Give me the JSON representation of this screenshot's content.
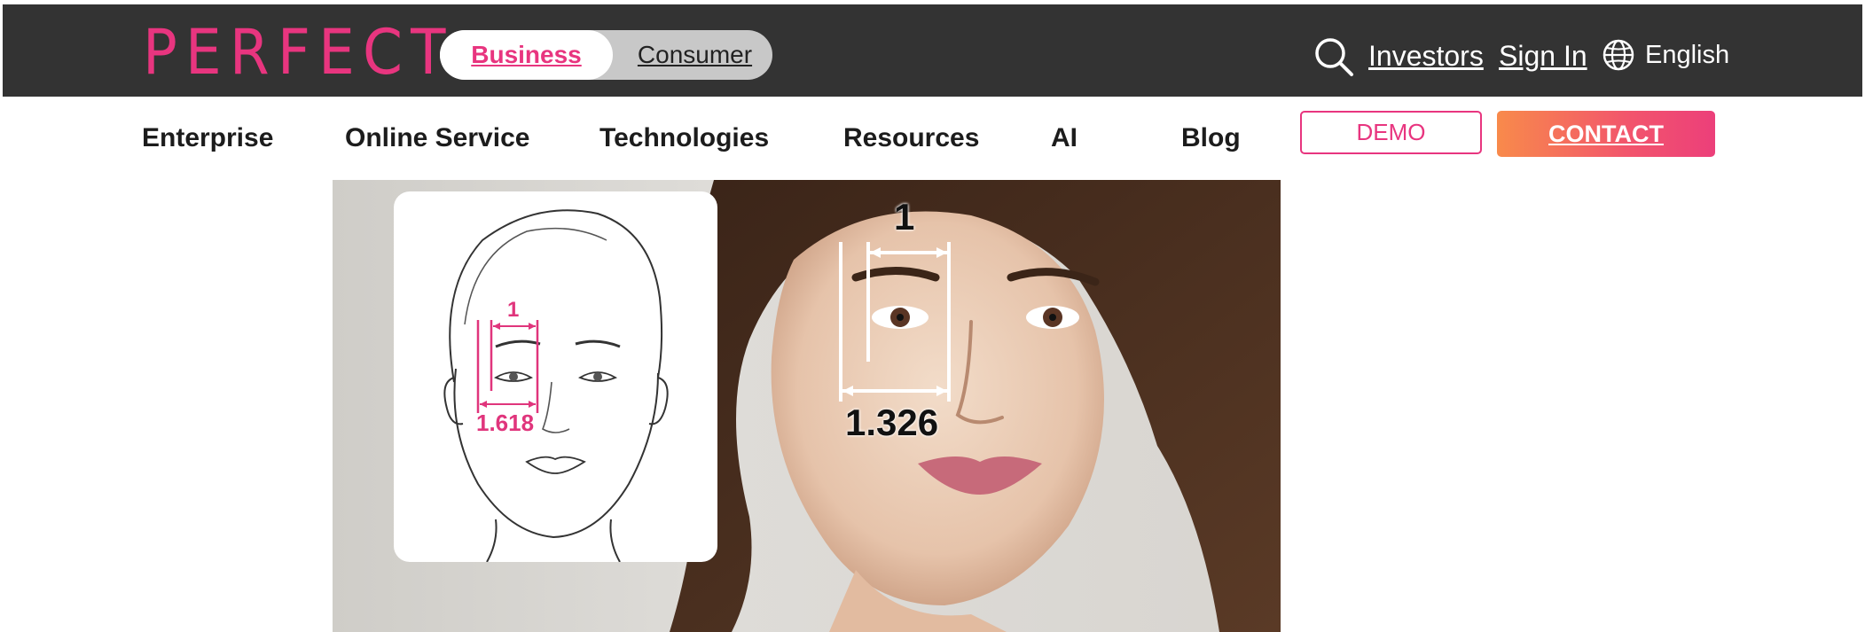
{
  "header": {
    "logo": "PERFECT",
    "toggle": {
      "business": "Business",
      "consumer": "Consumer"
    },
    "links": {
      "investors": "Investors",
      "sign_in": "Sign In"
    },
    "language": "English"
  },
  "nav": {
    "items": [
      "Enterprise",
      "Online Service",
      "Technologies",
      "Resources",
      "AI",
      "Blog"
    ],
    "demo": "DEMO",
    "contact": "CONTACT"
  },
  "hero": {
    "sketch_top_label": "1",
    "sketch_bottom_label": "1.618",
    "photo_top_label": "1",
    "photo_bottom_label": "1.326"
  },
  "colors": {
    "brand": "#e8357f",
    "topbar": "#333333"
  },
  "icons": {
    "search": "search-icon",
    "globe": "globe-icon"
  }
}
